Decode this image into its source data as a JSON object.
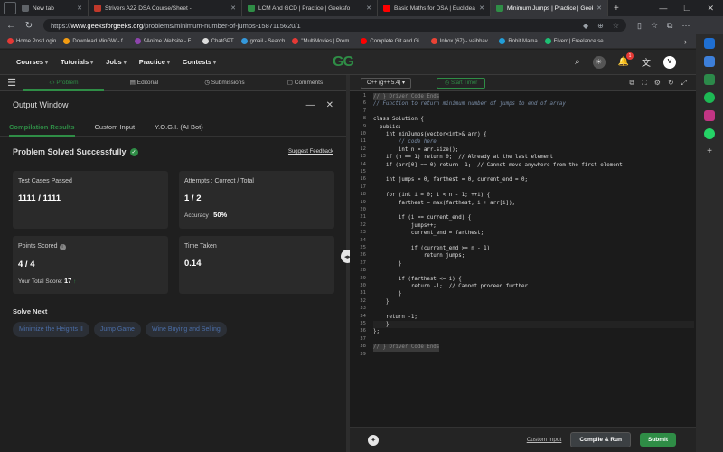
{
  "browser": {
    "tabs": [
      {
        "label": "New tab",
        "color": "#5f6368"
      },
      {
        "label": "Strivers A2Z DSA Course/Sheet -",
        "color": "#c0392b"
      },
      {
        "label": "LCM And GCD | Practice | Geeksfo",
        "color": "#2f8d46"
      },
      {
        "label": "Basic Maths for DSA | Euclidean A",
        "color": "#ff0000"
      },
      {
        "label": "Minimum Jumps | Practice | Geeks",
        "color": "#2f8d46"
      }
    ],
    "url_prefix": "https://",
    "url_host": "www.geeksforgeeks.org",
    "url_path": "/problems/minimum-number-of-jumps-1587115620/1",
    "bookmarks": [
      {
        "label": "Home PostLogin",
        "color": "#e53935"
      },
      {
        "label": "Download MinGW - f...",
        "color": "#f39c12"
      },
      {
        "label": "9Anime Website - F...",
        "color": "#8e44ad"
      },
      {
        "label": "ChatGPT",
        "color": "#dddddd"
      },
      {
        "label": "gmail - Search",
        "color": "#3498db"
      },
      {
        "label": "\"MultiMovies | Prem...",
        "color": "#e53935"
      },
      {
        "label": "Complete Git and Gi...",
        "color": "#ff0000"
      },
      {
        "label": "Inbox (67) - vaibhav...",
        "color": "#ea4335"
      },
      {
        "label": "Rohit Mama",
        "color": "#229ed9"
      },
      {
        "label": "Fiverr | Freelance se...",
        "color": "#1dbf73"
      }
    ]
  },
  "nav": {
    "menu": [
      "Courses",
      "Tutorials",
      "Jobs",
      "Practice",
      "Contests"
    ],
    "logo": "GG",
    "notif_count": "1",
    "avatar": "V"
  },
  "problem_tabs": [
    "Problem",
    "Editorial",
    "Submissions",
    "Comments"
  ],
  "output": {
    "title": "Output Window",
    "tabs": [
      "Compilation Results",
      "Custom Input",
      "Y.O.G.I. (AI Bot)"
    ],
    "status": "Problem Solved Successfully",
    "feedback": "Suggest Feedback",
    "test_label": "Test Cases Passed",
    "test_value": "1111 / 1111",
    "attempts_label": "Attempts : Correct / Total",
    "attempts_value": "1 / 2",
    "accuracy_label": "Accuracy :",
    "accuracy_value": "50%",
    "points_label": "Points Scored",
    "points_value": "4 / 4",
    "total_label": "Your Total Score:",
    "total_value": "17",
    "time_label": "Time Taken",
    "time_value": "0.14",
    "solve_next_label": "Solve Next",
    "solve_next": [
      "Minimize the Heights II",
      "Jump Game",
      "Wine Buying and Selling"
    ]
  },
  "editor": {
    "language": "C++ (g++ 5.4)",
    "timer": "Start Timer",
    "custom_input": "Custom Input",
    "compile": "Compile & Run",
    "submit": "Submit",
    "lines": [
      {
        "n": "1",
        "t": "// } Driver Code Ends",
        "k": "hl"
      },
      {
        "n": "6",
        "t": "// Function to return minimum number of jumps to end of array",
        "k": "cmt"
      },
      {
        "n": "7",
        "t": "",
        "k": ""
      },
      {
        "n": "8",
        "t": "class Solution {",
        "k": ""
      },
      {
        "n": "9",
        "t": "  public:",
        "k": ""
      },
      {
        "n": "10",
        "t": "    int minJumps(vector<int>& arr) {",
        "k": ""
      },
      {
        "n": "11",
        "t": "        // code here",
        "k": "cmt"
      },
      {
        "n": "12",
        "t": "        int n = arr.size();",
        "k": ""
      },
      {
        "n": "13",
        "t": "    if (n == 1) return 0;  // Already at the last element",
        "k": ""
      },
      {
        "n": "14",
        "t": "    if (arr[0] == 0) return -1;  // Cannot move anywhere from the first element",
        "k": ""
      },
      {
        "n": "15",
        "t": "",
        "k": ""
      },
      {
        "n": "16",
        "t": "    int jumps = 0, farthest = 0, current_end = 0;",
        "k": ""
      },
      {
        "n": "17",
        "t": "",
        "k": ""
      },
      {
        "n": "18",
        "t": "    for (int i = 0; i < n - 1; ++i) {",
        "k": ""
      },
      {
        "n": "19",
        "t": "        farthest = max(farthest, i + arr[i]);",
        "k": ""
      },
      {
        "n": "20",
        "t": "",
        "k": ""
      },
      {
        "n": "21",
        "t": "        if (i == current_end) {",
        "k": ""
      },
      {
        "n": "22",
        "t": "            jumps++;",
        "k": ""
      },
      {
        "n": "23",
        "t": "            current_end = farthest;",
        "k": ""
      },
      {
        "n": "24",
        "t": "",
        "k": ""
      },
      {
        "n": "25",
        "t": "            if (current_end >= n - 1)",
        "k": ""
      },
      {
        "n": "26",
        "t": "                return jumps;",
        "k": ""
      },
      {
        "n": "27",
        "t": "        }",
        "k": ""
      },
      {
        "n": "28",
        "t": "",
        "k": ""
      },
      {
        "n": "29",
        "t": "        if (farthest <= i) {",
        "k": ""
      },
      {
        "n": "30",
        "t": "            return -1;  // Cannot proceed further",
        "k": ""
      },
      {
        "n": "31",
        "t": "        }",
        "k": ""
      },
      {
        "n": "32",
        "t": "    }",
        "k": ""
      },
      {
        "n": "33",
        "t": "",
        "k": ""
      },
      {
        "n": "34",
        "t": "    return -1;",
        "k": ""
      },
      {
        "n": "35",
        "t": "    }",
        "k": "active"
      },
      {
        "n": "36",
        "t": "};",
        "k": ""
      },
      {
        "n": "37",
        "t": "",
        "k": ""
      },
      {
        "n": "38",
        "t": "// } Driver Code Ends",
        "k": "hl"
      },
      {
        "n": "39",
        "t": "",
        "k": ""
      }
    ]
  }
}
